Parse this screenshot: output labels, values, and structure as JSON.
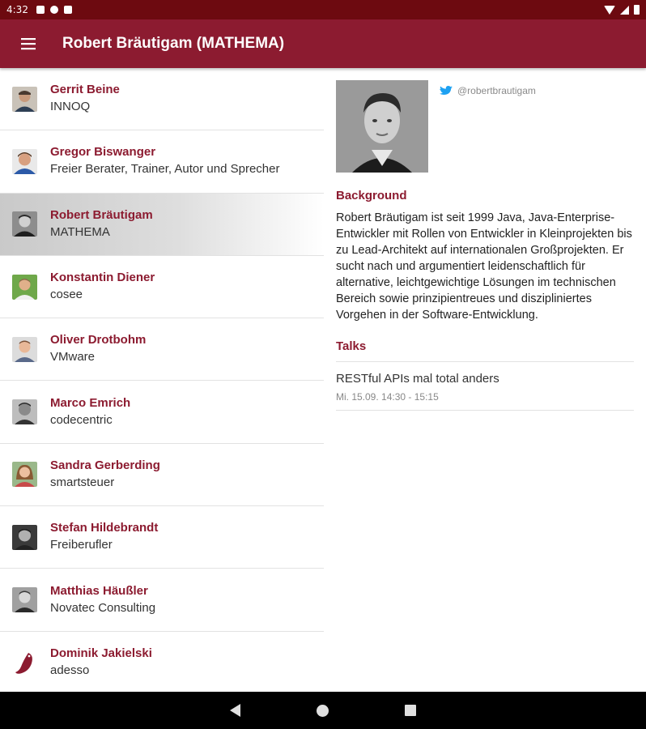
{
  "status_bar": {
    "time": "4:32"
  },
  "app_bar": {
    "title": "Robert Bräutigam (MATHEMA)",
    "menu_icon": "hamburger-menu-icon"
  },
  "speakers": [
    {
      "name": "Gerrit Beine",
      "company": "INNOQ"
    },
    {
      "name": "Gregor Biswanger",
      "company": "Freier Berater, Trainer, Autor und Sprecher"
    },
    {
      "name": "Robert Bräutigam",
      "company": "MATHEMA",
      "selected": true
    },
    {
      "name": "Konstantin Diener",
      "company": "cosee"
    },
    {
      "name": "Oliver Drotbohm",
      "company": "VMware"
    },
    {
      "name": "Marco Emrich",
      "company": "codecentric"
    },
    {
      "name": "Sandra Gerberding",
      "company": "smartsteuer"
    },
    {
      "name": "Stefan Hildebrandt",
      "company": "Freiberufler"
    },
    {
      "name": "Matthias Häußler",
      "company": "Novatec Consulting"
    },
    {
      "name": "Dominik Jakielski",
      "company": "adesso"
    }
  ],
  "detail": {
    "twitter_handle": "@robertbrautigam",
    "background_heading": "Background",
    "bio": "Robert Bräutigam ist seit 1999 Java, Java-Enterprise-Entwickler mit Rollen von Entwickler in Kleinprojekten bis zu Lead-Architekt auf internationalen Großprojekten. Er sucht nach und argumentiert leidenschaftlich für alternative, leichtgewichtige Lösungen im technischen Bereich sowie prinzipientreues und diszipliniertes Vorgehen in der Software-Entwicklung.",
    "talks_heading": "Talks",
    "talks": [
      {
        "title": "RESTful APIs mal total anders",
        "time": "Mi. 15.09. 14:30 - 15:15"
      }
    ]
  },
  "colors": {
    "primary": "#8c1b30",
    "status_bar": "#6d0a10",
    "twitter": "#1da1f2"
  }
}
